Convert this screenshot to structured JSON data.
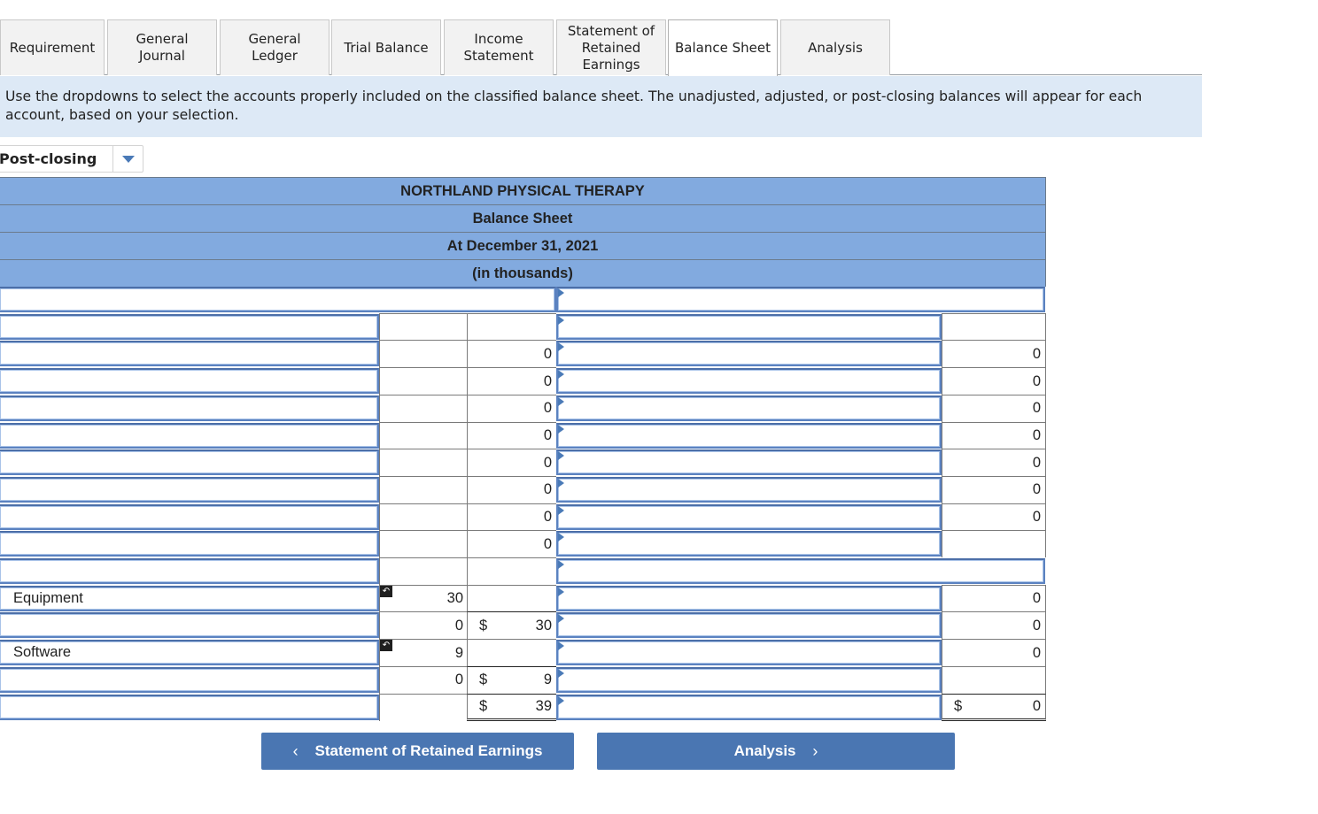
{
  "tabs": [
    {
      "label": "Requirement",
      "active": false
    },
    {
      "label": "General Journal",
      "active": false
    },
    {
      "label": "General Ledger",
      "active": false
    },
    {
      "label": "Trial Balance",
      "active": false
    },
    {
      "label": "Income Statement",
      "active": false
    },
    {
      "label": "Statement of Retained Earnings",
      "active": false
    },
    {
      "label": "Balance Sheet",
      "active": true
    },
    {
      "label": "Analysis",
      "active": false
    }
  ],
  "tab_lines": {
    "general_journal": [
      "General",
      "Journal"
    ],
    "general_ledger": [
      "General",
      "Ledger"
    ],
    "income_statement": [
      "Income",
      "Statement"
    ],
    "retained_earnings": [
      "Statement of",
      "Retained",
      "Earnings"
    ]
  },
  "instruction": "Use the dropdowns to select the accounts properly included on the classified balance sheet. The unadjusted, adjusted, or post-closing balances will appear for each account, based on your selection.",
  "balance_type_select": {
    "value": "Post-closing"
  },
  "sheet": {
    "company": "NORTHLAND PHYSICAL THERAPY",
    "title": "Balance Sheet",
    "date": "At December 31, 2021",
    "units": "(in thousands)"
  },
  "rows": [
    {
      "left_account": "",
      "left_amount1": "",
      "left_dollar": "",
      "left_amount2": "",
      "right_account": "",
      "right_dollar": "",
      "right_amount": ""
    },
    {
      "left_account": "",
      "left_amount1": "",
      "left_dollar": "",
      "left_amount2": "",
      "right_account": "",
      "right_dollar": "",
      "right_amount": ""
    },
    {
      "left_account": "",
      "left_amount1": "",
      "left_dollar": "",
      "left_amount2": "0",
      "right_account": "",
      "right_dollar": "",
      "right_amount": "0"
    },
    {
      "left_account": "",
      "left_amount1": "",
      "left_dollar": "",
      "left_amount2": "0",
      "right_account": "",
      "right_dollar": "",
      "right_amount": "0"
    },
    {
      "left_account": "",
      "left_amount1": "",
      "left_dollar": "",
      "left_amount2": "0",
      "right_account": "",
      "right_dollar": "",
      "right_amount": "0"
    },
    {
      "left_account": "",
      "left_amount1": "",
      "left_dollar": "",
      "left_amount2": "0",
      "right_account": "",
      "right_dollar": "",
      "right_amount": "0"
    },
    {
      "left_account": "",
      "left_amount1": "",
      "left_dollar": "",
      "left_amount2": "0",
      "right_account": "",
      "right_dollar": "",
      "right_amount": "0"
    },
    {
      "left_account": "",
      "left_amount1": "",
      "left_dollar": "",
      "left_amount2": "0",
      "right_account": "",
      "right_dollar": "",
      "right_amount": "0"
    },
    {
      "left_account": "",
      "left_amount1": "",
      "left_dollar": "",
      "left_amount2": "0",
      "right_account": "",
      "right_dollar": "",
      "right_amount": "0"
    },
    {
      "left_account": "",
      "left_amount1": "",
      "left_dollar": "",
      "left_amount2": "0",
      "right_account": "",
      "right_dollar": "",
      "right_amount": ""
    },
    {
      "left_account": "",
      "left_amount1": "",
      "left_dollar": "",
      "left_amount2": "",
      "right_account": "",
      "right_dollar": "",
      "right_amount": ""
    },
    {
      "left_account": "Equipment",
      "left_amount1": "30",
      "left_dollar": "",
      "left_amount2": "",
      "right_account": "",
      "right_dollar": "",
      "right_amount": "0"
    },
    {
      "left_account": "",
      "left_amount1": "0",
      "left_dollar": "$",
      "left_amount2": "30",
      "right_account": "",
      "right_dollar": "",
      "right_amount": "0"
    },
    {
      "left_account": "Software",
      "left_amount1": "9",
      "left_dollar": "",
      "left_amount2": "",
      "right_account": "",
      "right_dollar": "",
      "right_amount": "0"
    },
    {
      "left_account": "",
      "left_amount1": "0",
      "left_dollar": "$",
      "left_amount2": "9",
      "right_account": "",
      "right_dollar": "",
      "right_amount": ""
    },
    {
      "left_account": "",
      "left_amount1": "",
      "left_dollar": "$",
      "left_amount2": "39",
      "right_account": "",
      "right_dollar": "$",
      "right_amount": "0"
    }
  ],
  "nav": {
    "prev_label": "Statement of Retained Earnings",
    "next_label": "Analysis",
    "prev_icon": "chevron-left-icon",
    "next_icon": "chevron-right-icon"
  }
}
